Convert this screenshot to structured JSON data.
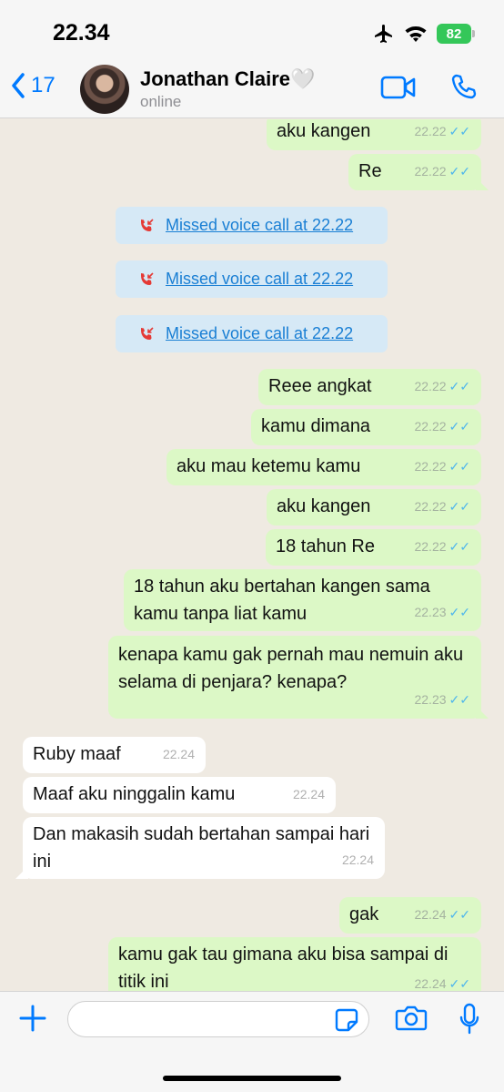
{
  "status": {
    "time": "22.34",
    "battery": "82"
  },
  "header": {
    "back_count": "17",
    "name": "Jonathan Claire🤍",
    "status": "online"
  },
  "messages": [
    {
      "text": "aku kangen",
      "time": "22.22"
    },
    {
      "text": "Re",
      "time": "22.22"
    },
    {
      "text": "Missed voice call at 22.22"
    },
    {
      "text": "Missed voice call at 22.22"
    },
    {
      "text": "Missed voice call at 22.22"
    },
    {
      "text": "Reee angkat",
      "time": "22.22"
    },
    {
      "text": "kamu dimana",
      "time": "22.22"
    },
    {
      "text": "aku mau ketemu kamu",
      "time": "22.22"
    },
    {
      "text": "aku kangen",
      "time": "22.22"
    },
    {
      "text": "18 tahun Re",
      "time": "22.22"
    },
    {
      "text": "18 tahun aku bertahan kangen sama kamu tanpa liat kamu",
      "time": "22.23"
    },
    {
      "text": "kenapa kamu gak pernah mau nemuin aku selama di penjara? kenapa?",
      "time": "22.23"
    },
    {
      "text": "Ruby maaf",
      "time": "22.24"
    },
    {
      "text": "Maaf aku ninggalin kamu",
      "time": "22.24"
    },
    {
      "text": "Dan makasih sudah bertahan sampai hari ini",
      "time": "22.24"
    },
    {
      "text": "gak",
      "time": "22.24"
    },
    {
      "text": "kamu gak tau gimana aku bisa sampai di titik ini",
      "time": "22.24"
    }
  ],
  "icons": {
    "back": "chevron-left-icon",
    "video": "video-camera-icon",
    "call": "phone-icon",
    "missed": "missed-call-icon",
    "plus": "plus-icon",
    "sticker": "sticker-icon",
    "camera": "camera-icon",
    "mic": "microphone-icon"
  },
  "colors": {
    "outgoing": "#dcf8c6",
    "incoming": "#ffffff",
    "accent": "#007aff",
    "missed_bg": "#d6e9f6",
    "ticks": "#4fb6ec"
  }
}
